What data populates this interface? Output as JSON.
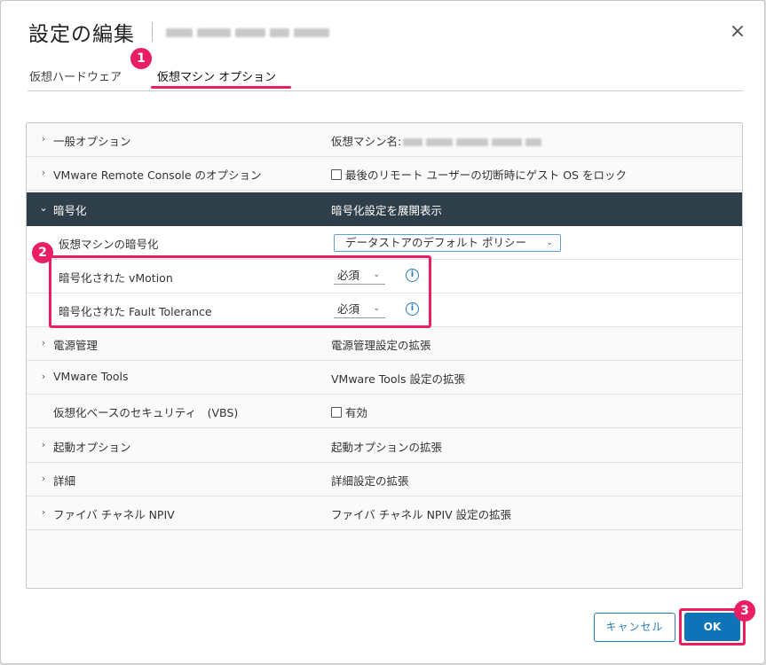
{
  "dialog": {
    "title": "設定の編集",
    "close_icon": "×"
  },
  "tabs": [
    {
      "label": "仮想ハードウェア"
    },
    {
      "label": "仮想マシン オプション"
    }
  ],
  "badges": {
    "b1": "1",
    "b2": "2",
    "b3": "3"
  },
  "rows": {
    "general": {
      "label": "一般オプション",
      "value": "仮想マシン名:"
    },
    "vmrc": {
      "label": "VMware Remote Console のオプション",
      "value": "最後のリモート ユーザーの切断時にゲスト OS をロック"
    },
    "encryption": {
      "label": "暗号化",
      "value": "暗号化設定を展開表示"
    },
    "vm_encryption": {
      "label": "仮想マシンの暗号化",
      "value": "データストアのデフォルト ポリシー"
    },
    "enc_vmotion": {
      "label": "暗号化された vMotion",
      "value": "必須"
    },
    "enc_ft": {
      "label": "暗号化された Fault Tolerance",
      "value": "必須"
    },
    "power": {
      "label": "電源管理",
      "value": "電源管理設定の拡張"
    },
    "tools": {
      "label": "VMware Tools",
      "value": "VMware Tools 設定の拡張"
    },
    "vbs": {
      "label": "仮想化ベースのセキュリティ　(VBS)",
      "value": "有効"
    },
    "boot": {
      "label": "起動オプション",
      "value": "起動オプションの拡張"
    },
    "advanced": {
      "label": "詳細",
      "value": "詳細設定の拡張"
    },
    "npiv": {
      "label": "ファイバ チャネル NPIV",
      "value": "ファイバ チャネル NPIV 設定の拡張"
    }
  },
  "icons": {
    "chevron_right": "›",
    "chevron_down": "⌄",
    "caret": "⌄",
    "info": "i"
  },
  "buttons": {
    "cancel": "キャンセル",
    "ok": "OK"
  },
  "colors": {
    "accent": "#e91e63",
    "header_bg": "#2f3f4a",
    "primary": "#0f73b8"
  }
}
